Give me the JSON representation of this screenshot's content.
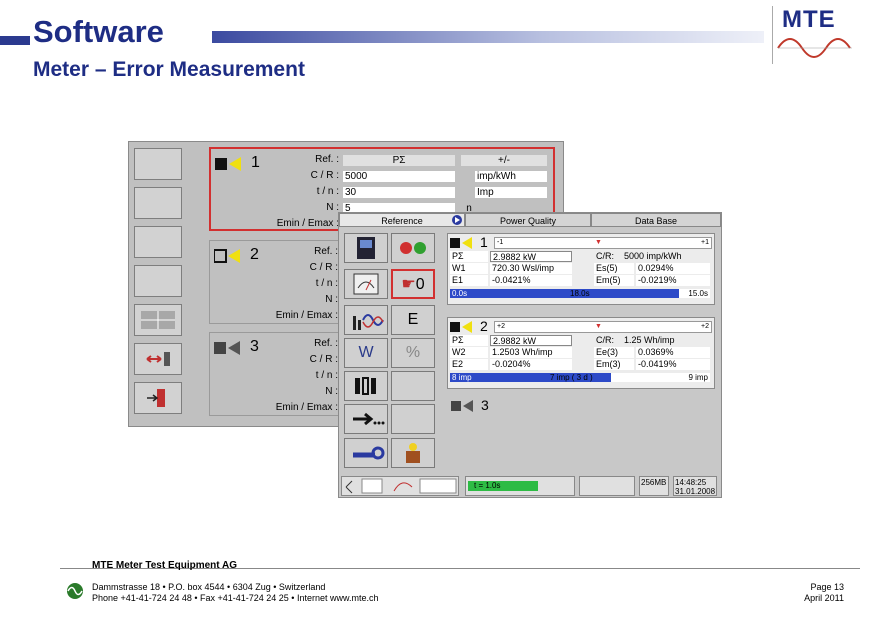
{
  "header": {
    "title": "Software",
    "subtitle": "Meter – Error Measurement",
    "logo_text": "MTE"
  },
  "back_window": {
    "meters": [
      {
        "number": "1",
        "labels": [
          "Ref. :",
          "C / R :",
          "t / n :",
          "N :",
          "Emin / Emax :"
        ],
        "ref_value": "PΣ",
        "ref_right": "+/-",
        "cr_value": "5000",
        "cr_unit": "imp/kWh",
        "tn_value": "30",
        "tn_unit": "Imp",
        "n_value": "5",
        "n_unit": "n"
      },
      {
        "number": "2",
        "labels": [
          "Ref. :",
          "C / R :",
          "t / n :",
          "N :",
          "Emin / Emax :"
        ]
      },
      {
        "number": "3",
        "labels": [
          "Ref. :",
          "C / R :",
          "t / n :",
          "N :",
          "Emin / Emax :"
        ]
      }
    ]
  },
  "front_window": {
    "tabs": [
      "Reference",
      "Power Quality",
      "Data Base"
    ],
    "icon_buttons": [
      "W",
      "0",
      "E",
      "%"
    ],
    "meter1": {
      "number": "1",
      "scale_left": "-1",
      "scale_right": "+1",
      "rows": [
        [
          "PΣ",
          "2.9882 kW",
          "C/R:",
          "5000 imp/kWh"
        ],
        [
          "W1",
          "720.30  Wsl/imp",
          "Es(5)",
          "0.0294%"
        ],
        [
          "E1",
          "-0.0421%",
          "Em(5)",
          "-0.0219%"
        ]
      ],
      "bar_left": "0.0s",
      "bar_mid": "18.0s",
      "bar_right": "15.0s",
      "progress": 0.88
    },
    "meter2": {
      "number": "2",
      "scale_left": "+2",
      "scale_right": "+2",
      "rows": [
        [
          "PΣ",
          "2.9882 kW",
          "C/R:",
          "1.25 Wh/imp"
        ],
        [
          "W2",
          "1.2503   Wh/imp",
          "Ee(3)",
          "0.0369%"
        ],
        [
          "E2",
          "-0.0204%",
          "Em(3)",
          "-0.0419%"
        ]
      ],
      "bar_left": "8 imp",
      "bar_mid": "7 imp  ( 3 d )",
      "bar_right": "9 imp",
      "progress": 0.62
    },
    "meter3": {
      "number": "3"
    },
    "status": {
      "t_value": "t = 1.0s",
      "memory": "256MB",
      "time": "14:48:25",
      "date": "31.01.2008"
    }
  },
  "footer": {
    "company": "MTE Meter Test Equipment AG",
    "address": "Dammstrasse 18 • P.O. box 4544 • 6304 Zug • Switzerland",
    "contact": "Phone +41-41-724 24 48 • Fax +41-41-724 24 25 • Internet www.mte.ch",
    "page": "Page 13",
    "date": "April 2011"
  },
  "colors": {
    "brand": "#1e2d84",
    "highlight": "#d23030",
    "progress": "#2d4ac8"
  }
}
